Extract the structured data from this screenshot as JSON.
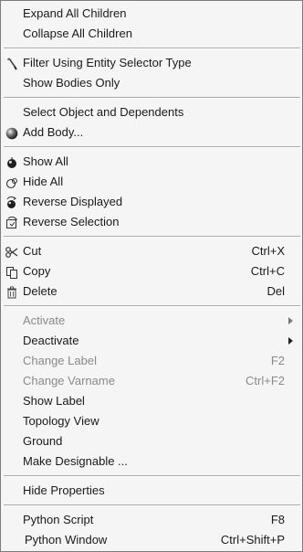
{
  "menu": {
    "items": [
      {
        "label": "Expand All Children"
      },
      {
        "label": "Collapse All Children"
      },
      {
        "label": "Filter Using Entity Selector Type",
        "icon": "filter-wand-icon"
      },
      {
        "label": "Show Bodies Only"
      },
      {
        "label": "Select Object and Dependents"
      },
      {
        "label": "Add Body...",
        "icon": "body-sphere-icon"
      },
      {
        "label": "Show All",
        "icon": "show-all-icon"
      },
      {
        "label": "Hide All",
        "icon": "hide-all-icon"
      },
      {
        "label": "Reverse Displayed",
        "icon": "reverse-displayed-icon"
      },
      {
        "label": "Reverse Selection",
        "icon": "reverse-selection-icon"
      },
      {
        "label": "Cut",
        "shortcut": "Ctrl+X",
        "icon": "scissors-icon"
      },
      {
        "label": "Copy",
        "shortcut": "Ctrl+C",
        "icon": "copy-icon"
      },
      {
        "label": "Delete",
        "shortcut": "Del",
        "icon": "trash-icon"
      },
      {
        "label": "Activate",
        "disabled": true,
        "submenu": true
      },
      {
        "label": "Deactivate",
        "submenu": true
      },
      {
        "label": "Change Label",
        "shortcut": "F2",
        "disabled": true
      },
      {
        "label": "Change Varname",
        "shortcut": "Ctrl+F2",
        "disabled": true
      },
      {
        "label": "Show Label"
      },
      {
        "label": "Topology View"
      },
      {
        "label": "Ground"
      },
      {
        "label": "Make Designable ..."
      },
      {
        "label": "Hide Properties"
      },
      {
        "label": "Python Script",
        "shortcut": "F8"
      },
      {
        "label": "Python Window",
        "shortcut": "Ctrl+Shift+P"
      }
    ]
  },
  "colors": {
    "background": "#f5f5f5",
    "text": "#1a1a1a",
    "disabled_text": "#8a8a8a",
    "separator": "#a9a9a9",
    "border": "#7d7d7d"
  }
}
